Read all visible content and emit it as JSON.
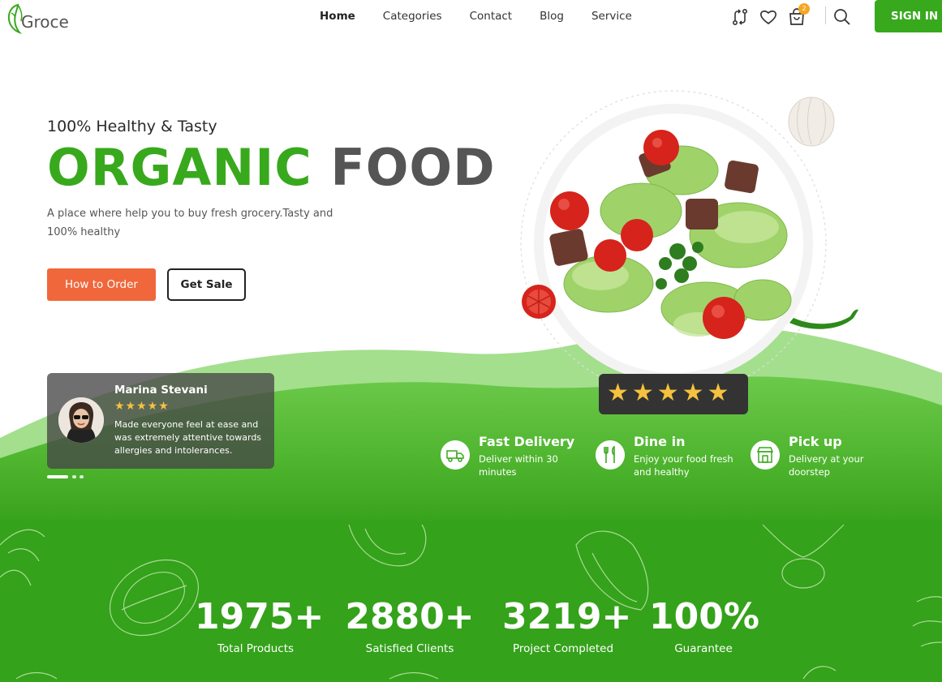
{
  "brand": {
    "name": "Groce"
  },
  "nav": {
    "items": [
      {
        "label": "Home",
        "active": true
      },
      {
        "label": "Categories",
        "active": false
      },
      {
        "label": "Contact",
        "active": false
      },
      {
        "label": "Blog",
        "active": false
      },
      {
        "label": "Service",
        "active": false
      }
    ],
    "cart_count": "2",
    "signin_label": "SIGN IN",
    "icons": [
      "compare-icon",
      "heart-icon",
      "cart-icon",
      "search-icon"
    ]
  },
  "hero": {
    "subtitle": "100% Healthy & Tasty",
    "title_green": "ORGANIC",
    "title_dark": "FOOD",
    "description": "A place where help you to buy fresh grocery.Tasty and 100% healthy",
    "primary_button": "How to Order",
    "secondary_button": "Get Sale"
  },
  "testimonial": {
    "name": "Marina Stevani",
    "rating": 4.5,
    "stars": "★★★★★",
    "text": "Made everyone feel at ease and was extremely attentive towards allergies and intolerances."
  },
  "rating_badge": {
    "stars": "★★★★★",
    "rating": 5
  },
  "features": [
    {
      "title": "Fast Delivery",
      "desc": "Deliver within 30 minutes",
      "icon": "truck-icon"
    },
    {
      "title": "Dine in",
      "desc": "Enjoy your food fresh and healthy",
      "icon": "cutlery-icon"
    },
    {
      "title": "Pick up",
      "desc": "Delivery at your doorstep",
      "icon": "store-icon"
    }
  ],
  "stats": [
    {
      "value": "1975+",
      "label": "Total Products"
    },
    {
      "value": "2880+",
      "label": "Satisfied Clients"
    },
    {
      "value": "3219+",
      "label": "Project Completed"
    },
    {
      "value": "100%",
      "label": "Guarantee"
    }
  ],
  "colors": {
    "brand_green": "#38a91d",
    "accent_orange": "#f0673b",
    "star_yellow": "#f6c23e",
    "badge_orange": "#f5a623"
  }
}
